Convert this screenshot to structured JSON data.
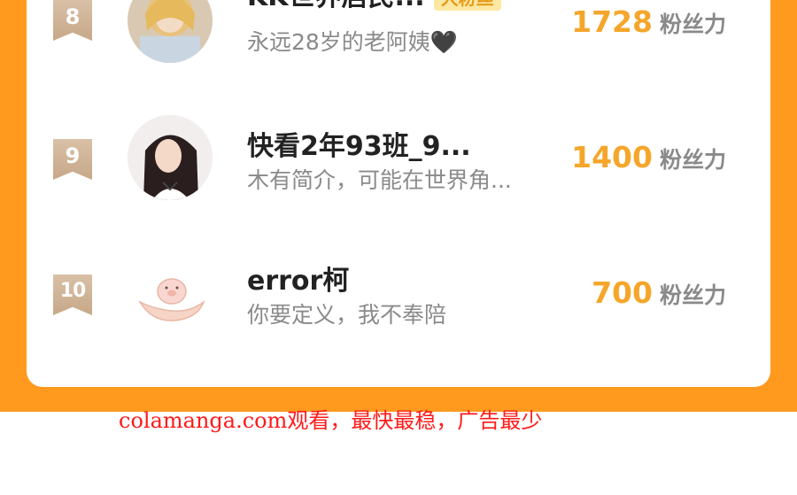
{
  "leaderboard": {
    "rows": [
      {
        "rank": "8",
        "name": "KK世界居民...",
        "badge": "大粉丝",
        "bio": "永远28岁的老阿姨🖤",
        "score": "1728",
        "unit": "粉丝力",
        "avatar_icon": "avatar-blonde-girl"
      },
      {
        "rank": "9",
        "name": "快看2年93班_9...",
        "badge": "",
        "bio": "木有简介，可能在世界角...",
        "score": "1400",
        "unit": "粉丝力",
        "avatar_icon": "avatar-dark-hair-girl"
      },
      {
        "rank": "10",
        "name": "error柯",
        "badge": "",
        "bio": "你要定义，我不奉陪",
        "score": "700",
        "unit": "粉丝力",
        "avatar_icon": "avatar-pig-in-hands"
      }
    ]
  },
  "footer": {
    "text": "colamanga.com观看，最快最稳，广告最少"
  },
  "colors": {
    "orange": "#ff9a1e",
    "score": "#f5a62a",
    "badge_bg": "#fde8a2",
    "footer_red": "#ff1a1a"
  }
}
